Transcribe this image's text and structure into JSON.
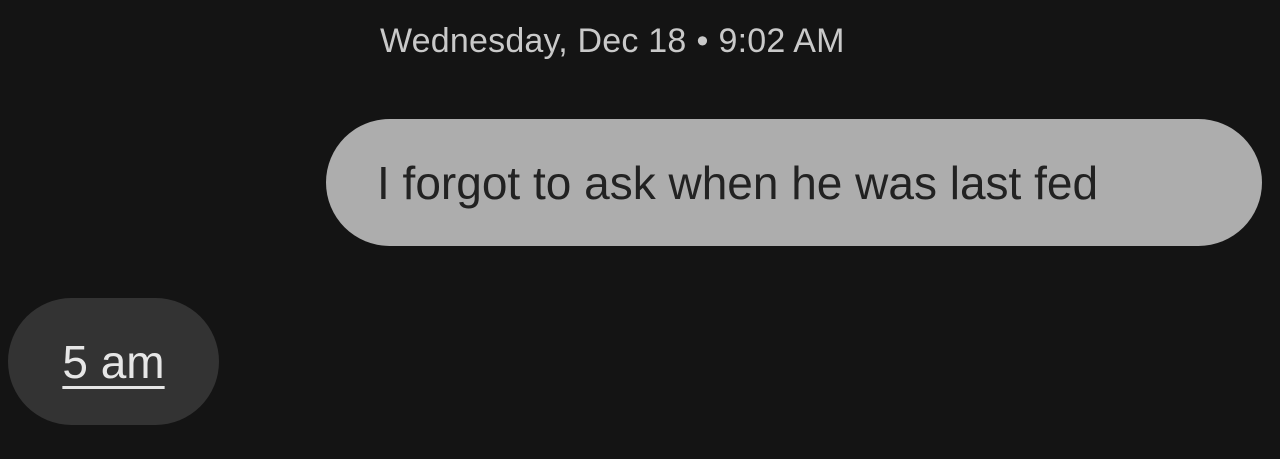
{
  "conversation": {
    "timestamp": {
      "day": "Wednesday, Dec 18",
      "separator": "•",
      "time": "9:02 AM"
    },
    "messages": [
      {
        "direction": "outgoing",
        "text": "I forgot to ask when he was last fed"
      },
      {
        "direction": "incoming",
        "text": "5 am",
        "linked": true
      }
    ]
  },
  "colors": {
    "background": "#141414",
    "outgoing_bubble": "#adadad",
    "incoming_bubble": "#333333",
    "timestamp_text": "#c9c9c9"
  }
}
